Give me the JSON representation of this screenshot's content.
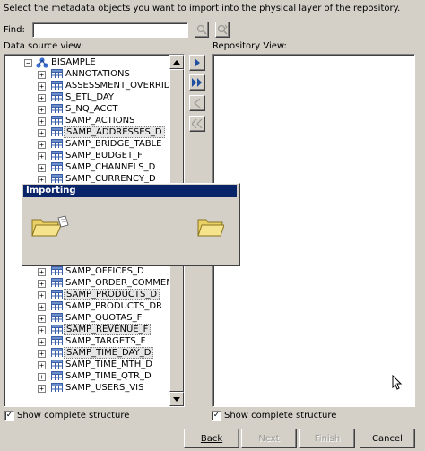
{
  "instruction": "Select the metadata objects you want to import into the physical layer of the repository.",
  "find": {
    "label": "Find:",
    "value": "",
    "find_button_icon": "find-icon",
    "find_next_button_icon": "find-next-icon"
  },
  "left_panel": {
    "label": "Data source view:",
    "root_label": "BISAMPLE",
    "items_top": [
      "ANNOTATIONS",
      "ASSESSMENT_OVERRID...",
      "S_ETL_DAY",
      "S_NQ_ACCT",
      "SAMP_ACTIONS",
      "SAMP_ADDRESSES_D",
      "SAMP_BRIDGE_TABLE",
      "SAMP_BUDGET_F",
      "SAMP_CHANNELS_D",
      "SAMP_CURRENCY_D"
    ],
    "items_bottom": [
      "SAMP_OFFICES_D",
      "SAMP_ORDER_COMMEN...",
      "SAMP_PRODUCTS_D",
      "SAMP_PRODUCTS_DR",
      "SAMP_QUOTAS_F",
      "SAMP_REVENUE_F",
      "SAMP_TARGETS_F",
      "SAMP_TIME_DAY_D",
      "SAMP_TIME_MTH_D",
      "SAMP_TIME_QTR_D",
      "SAMP_USERS_VIS"
    ],
    "show_complete_structure": "Show complete structure",
    "checked": true
  },
  "move_buttons": {
    "add_selected": "arrow-right-icon",
    "add_all": "double-arrow-right-icon",
    "remove_selected": "arrow-left-icon",
    "remove_all": "double-arrow-left-icon"
  },
  "right_panel": {
    "label": "Repository View:",
    "show_complete_structure": "Show complete structure",
    "checked": true
  },
  "importing_dialog": {
    "title": "Importing"
  },
  "footer": {
    "back": "Back",
    "next": "Next",
    "finish": "Finish",
    "cancel": "Cancel"
  },
  "colors": {
    "dialog_title_bg": "#0a246a",
    "face": "#d4d0c8",
    "selection_bg": "#e6e6e6",
    "move_button_active": "#1f4fa0"
  }
}
